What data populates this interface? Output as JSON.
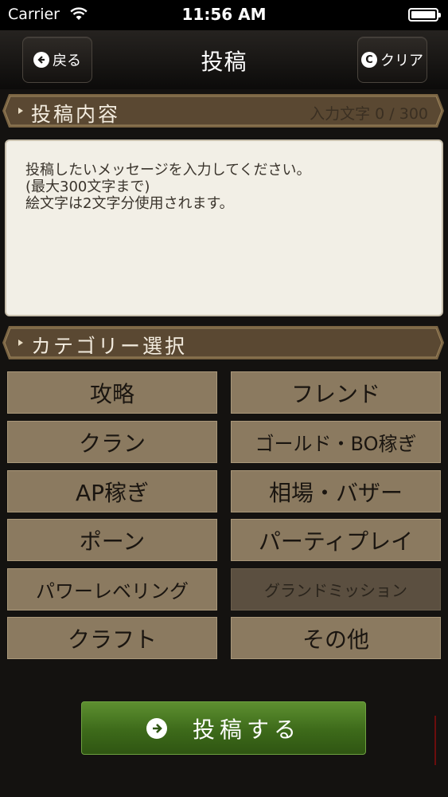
{
  "status_bar": {
    "carrier": "Carrier",
    "time": "11:56 AM"
  },
  "nav": {
    "back_label": "戻る",
    "title": "投稿",
    "clear_label": "クリア"
  },
  "post_section": {
    "title": "投稿内容",
    "counter": "入力文字 0 / 300"
  },
  "message": {
    "placeholder": "投稿したいメッセージを入力してください。\n(最大300文字まで)\n絵文字は2文字分使用されます。"
  },
  "category_section": {
    "title": "カテゴリー選択"
  },
  "categories": [
    {
      "label": "攻略"
    },
    {
      "label": "フレンド"
    },
    {
      "label": "クラン"
    },
    {
      "label": "ゴールド・BO稼ぎ"
    },
    {
      "label": "AP稼ぎ"
    },
    {
      "label": "相場・バザー"
    },
    {
      "label": "ポーン"
    },
    {
      "label": "パーティプレイ"
    },
    {
      "label": "パワーレベリング"
    },
    {
      "label": "グランドミッション"
    },
    {
      "label": "クラフト"
    },
    {
      "label": "その他"
    }
  ],
  "submit": {
    "label": "投稿する"
  },
  "colors": {
    "category_bg": "#8b7a60",
    "category_selected_bg": "#5b4f40",
    "header_bg": "#5a4832",
    "submit_green": "#3d6a1a"
  },
  "icons": {
    "back": "arrow-left-circle-icon",
    "clear": "c-circle-icon",
    "submit": "arrow-right-circle-icon"
  }
}
